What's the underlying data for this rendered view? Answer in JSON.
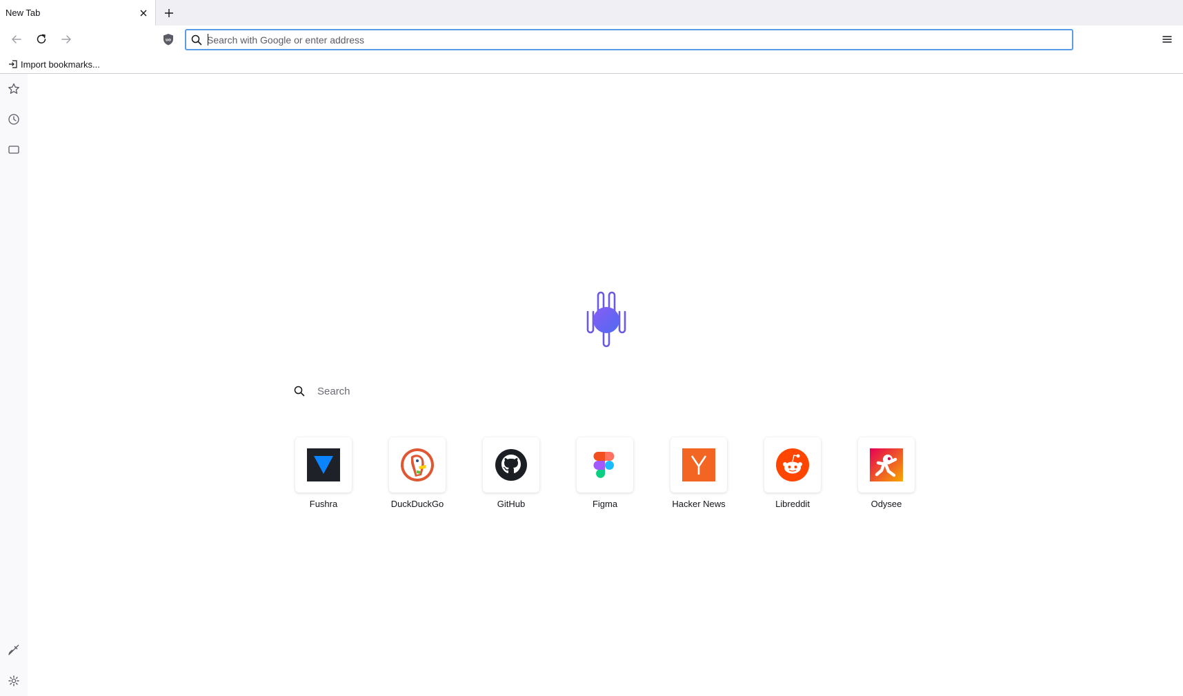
{
  "tabs": [
    {
      "title": "New Tab"
    }
  ],
  "urlbar": {
    "placeholder": "Search with Google or enter address",
    "value": ""
  },
  "bookmarks_toolbar": {
    "import_label": "Import bookmarks..."
  },
  "content_search": {
    "placeholder": "Search"
  },
  "top_sites": [
    {
      "label": "Fushra"
    },
    {
      "label": "DuckDuckGo"
    },
    {
      "label": "GitHub"
    },
    {
      "label": "Figma"
    },
    {
      "label": "Hacker News"
    },
    {
      "label": "Libreddit"
    },
    {
      "label": "Odysee"
    }
  ],
  "icons": {
    "tab_close": "close-icon",
    "new_tab": "plus-icon",
    "back": "back-arrow-icon",
    "reload": "reload-icon",
    "forward": "forward-arrow-icon",
    "shield": "ublock-shield-icon",
    "menu": "hamburger-menu-icon",
    "sidebar": [
      "star-icon",
      "clock-icon",
      "tab-icon",
      "brush-icon",
      "gear-icon"
    ]
  },
  "colors": {
    "urlbar_focus": "#5a9de6",
    "logo_purple": "#6a5ae0"
  }
}
